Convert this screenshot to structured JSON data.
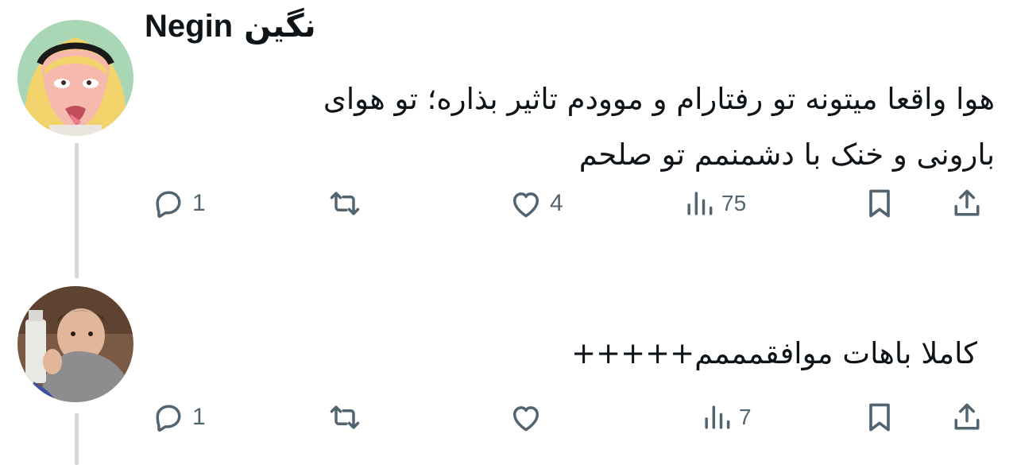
{
  "tweets": [
    {
      "author": {
        "name": "Negin",
        "name_fa": "نگین"
      },
      "text_lines": [
        "هوا واقعا میتونه تو رفتارام و موودم تاثیر بذاره؛ تو هوای",
        "بارونی و خنک با دشمنمم تو صلحم"
      ],
      "stats": {
        "replies": "1",
        "likes": "4",
        "views": "75"
      }
    },
    {
      "text_lines": [
        "کاملا باهات موافقمممم+++++"
      ],
      "stats": {
        "replies": "1",
        "likes": "",
        "views": "7"
      }
    }
  ],
  "icons": {
    "reply": "reply-icon",
    "retweet": "retweet-icon",
    "like": "heart-icon",
    "views": "views-icon",
    "bookmark": "bookmark-icon",
    "share": "share-icon"
  },
  "colors": {
    "text": "#0f1419",
    "icon": "#536471",
    "thread_line": "#cfd9de"
  }
}
